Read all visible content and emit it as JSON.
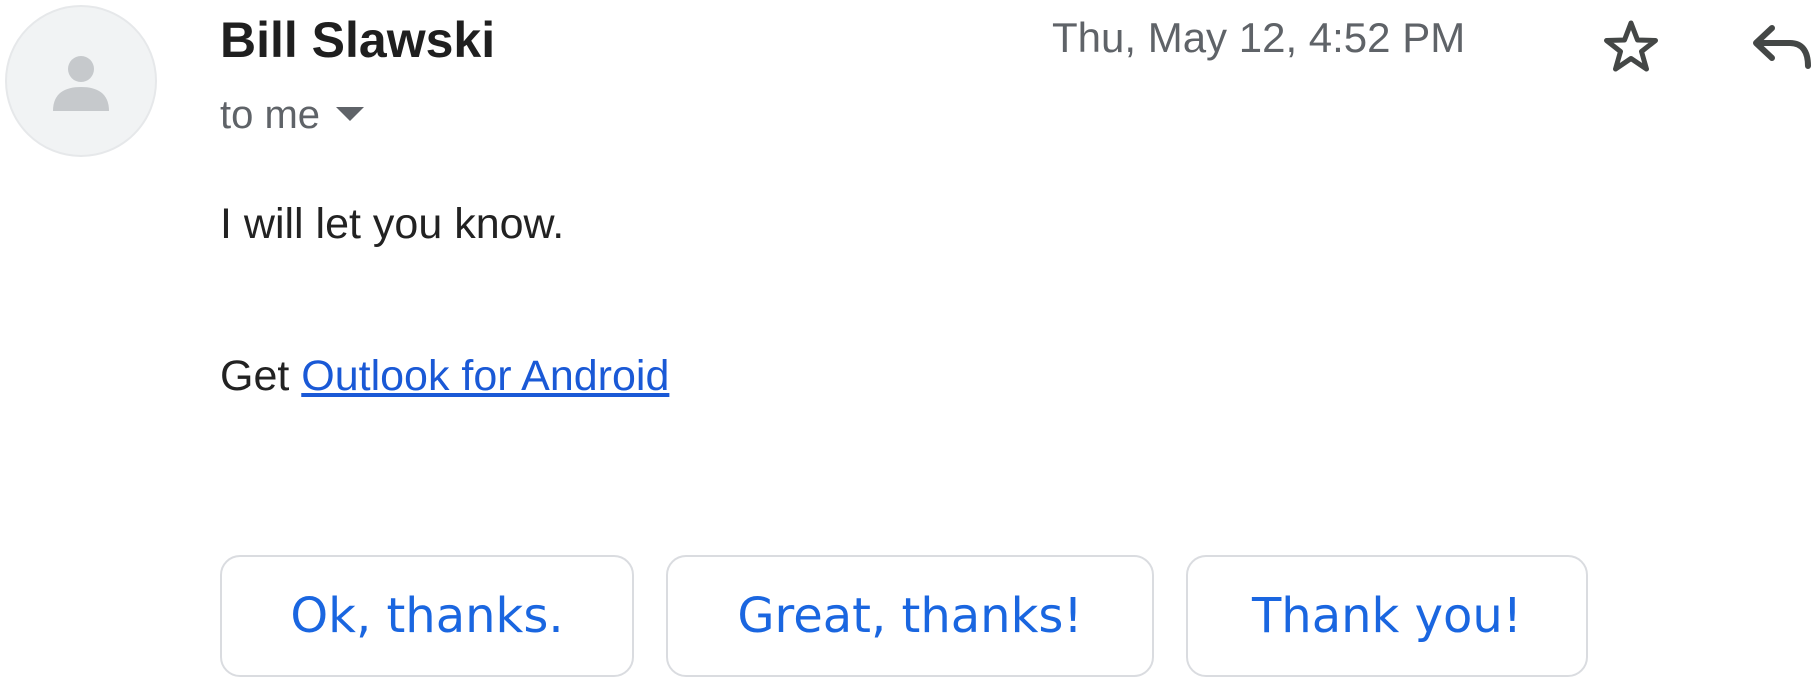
{
  "message": {
    "sender": "Bill Slawski",
    "recipient_label": "to me",
    "timestamp": "Thu, May 12, 4:52 PM",
    "body_line_1": "I will let you know.",
    "body_line_2_prefix": "Get",
    "link_text": "Outlook for Android"
  },
  "icons": {
    "avatar": "default-person-icon",
    "recipient_caret": "caret-down-icon",
    "star": "star-outline-icon",
    "reply": "reply-arrow-icon"
  },
  "smart_replies": [
    "Ok, thanks.",
    "Great, thanks!",
    "Thank you!"
  ],
  "colors": {
    "link": "#1a59d6",
    "smart_reply_text": "#1a66e0",
    "secondary_text": "#5f6368",
    "chip_border": "#dadce0"
  }
}
